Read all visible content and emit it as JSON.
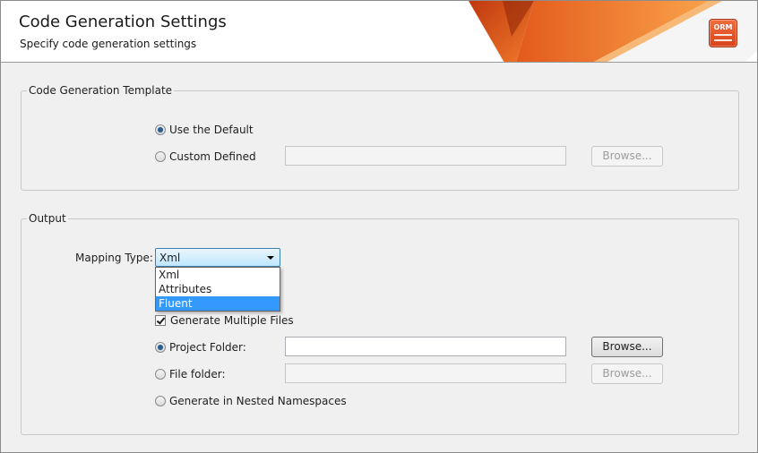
{
  "header": {
    "title": "Code Generation Settings",
    "subtitle": "Specify code generation settings",
    "logo_text": "ORM"
  },
  "template_group": {
    "title": "Code Generation Template",
    "use_default_label": "Use the Default",
    "use_default_checked": true,
    "custom_defined_label": "Custom Defined",
    "custom_defined_checked": false,
    "custom_path_value": "",
    "browse_label": "Browse..."
  },
  "output_group": {
    "title": "Output",
    "mapping_type_label": "Mapping Type:",
    "mapping_type_value": "Xml",
    "mapping_type_options": [
      "Xml",
      "Attributes",
      "Fluent"
    ],
    "mapping_type_highlighted": "Fluent",
    "generate_multiple_label": "Generate Multiple Files",
    "generate_multiple_checked": true,
    "project_folder_label": "Project Folder:",
    "project_folder_checked": true,
    "project_folder_value": "",
    "project_browse_label": "Browse...",
    "file_folder_label": "File folder:",
    "file_folder_checked": false,
    "file_folder_value": "",
    "file_browse_label": "Browse...",
    "nested_namespaces_label": "Generate in Nested Namespaces",
    "nested_namespaces_checked": false
  },
  "colors": {
    "accent_orange": "#e8541e",
    "selection_blue": "#3399ff",
    "combo_border": "#3c7fb1"
  }
}
